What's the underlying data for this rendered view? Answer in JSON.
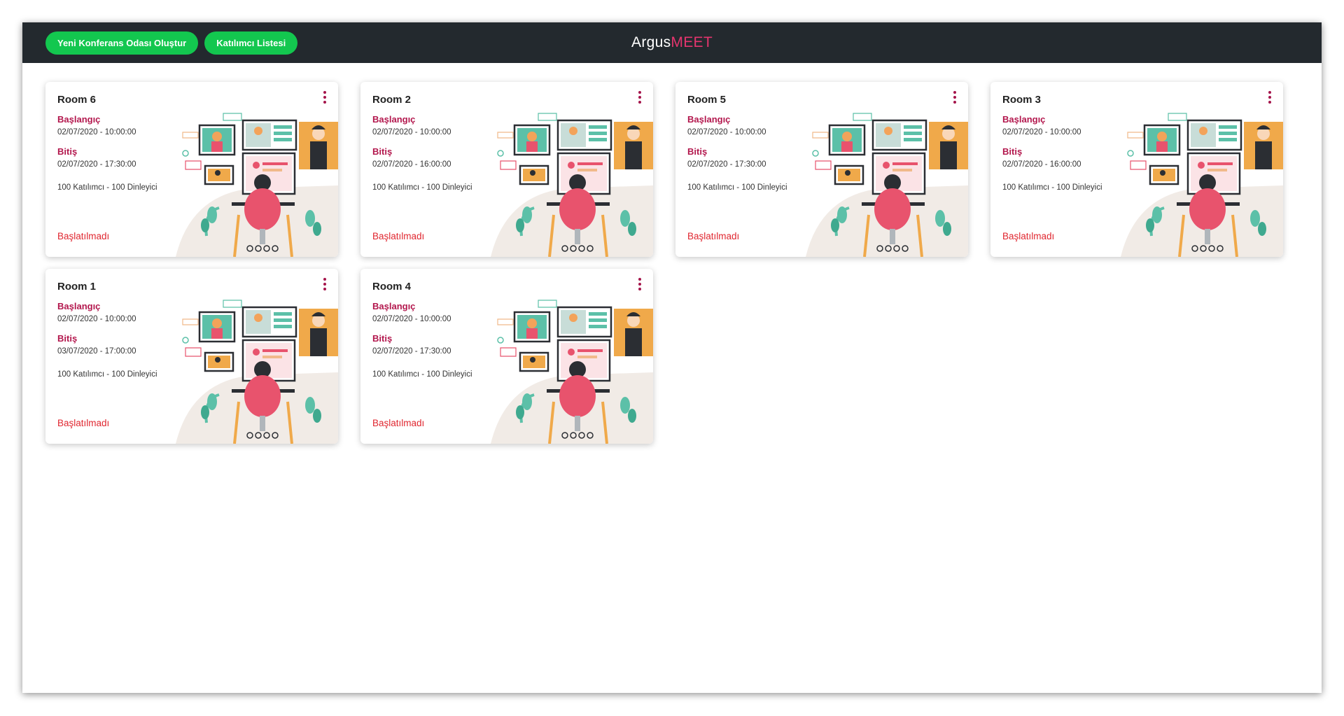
{
  "topbar": {
    "create_room_label": "Yeni Konferans Odası Oluştur",
    "participants_label": "Katılımcı Listesi",
    "brand_part1": "Argus",
    "brand_part2": "MEET"
  },
  "colors": {
    "topbar_bg": "#23292e",
    "button_green": "#13c74f",
    "brand_accent": "#e5356e",
    "label_crimson": "#b3174d",
    "status_red": "#e0262f"
  },
  "icons": {
    "card_menu": "more-vertical-icon",
    "card_image": "video-conference-illustration"
  },
  "rooms": [
    {
      "title": "Room 6",
      "start_label": "Başlangıç",
      "start": "02/07/2020 - 10:00:00",
      "end_label": "Bitiş",
      "end": "02/07/2020 - 17:30:00",
      "capacity": "100 Katılımcı - 100 Dinleyici",
      "status": "Başlatılmadı"
    },
    {
      "title": "Room 2",
      "start_label": "Başlangıç",
      "start": "02/07/2020 - 10:00:00",
      "end_label": "Bitiş",
      "end": "02/07/2020 - 16:00:00",
      "capacity": "100 Katılımcı - 100 Dinleyici",
      "status": "Başlatılmadı"
    },
    {
      "title": "Room 5",
      "start_label": "Başlangıç",
      "start": "02/07/2020 - 10:00:00",
      "end_label": "Bitiş",
      "end": "02/07/2020 - 17:30:00",
      "capacity": "100 Katılımcı - 100 Dinleyici",
      "status": "Başlatılmadı"
    },
    {
      "title": "Room 3",
      "start_label": "Başlangıç",
      "start": "02/07/2020 - 10:00:00",
      "end_label": "Bitiş",
      "end": "02/07/2020 - 16:00:00",
      "capacity": "100 Katılımcı - 100 Dinleyici",
      "status": "Başlatılmadı"
    },
    {
      "title": "Room 1",
      "start_label": "Başlangıç",
      "start": "02/07/2020 - 10:00:00",
      "end_label": "Bitiş",
      "end": "03/07/2020 - 17:00:00",
      "capacity": "100 Katılımcı - 100 Dinleyici",
      "status": "Başlatılmadı"
    },
    {
      "title": "Room 4",
      "start_label": "Başlangıç",
      "start": "02/07/2020 - 10:00:00",
      "end_label": "Bitiş",
      "end": "02/07/2020 - 17:30:00",
      "capacity": "100 Katılımcı - 100 Dinleyici",
      "status": "Başlatılmadı"
    }
  ]
}
